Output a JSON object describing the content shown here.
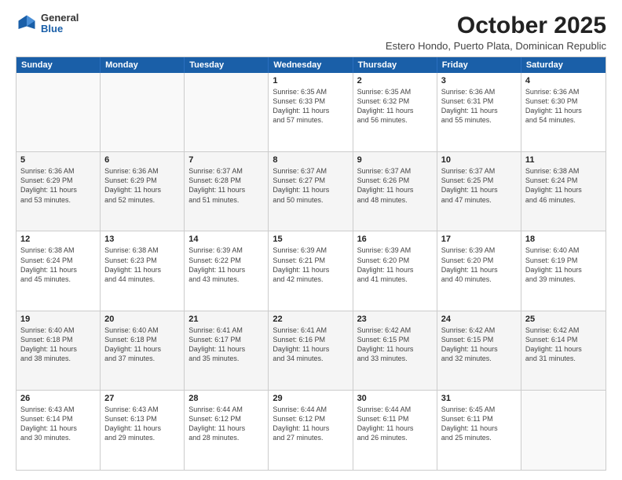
{
  "logo": {
    "general": "General",
    "blue": "Blue"
  },
  "header": {
    "month": "October 2025",
    "subtitle": "Estero Hondo, Puerto Plata, Dominican Republic"
  },
  "weekdays": [
    "Sunday",
    "Monday",
    "Tuesday",
    "Wednesday",
    "Thursday",
    "Friday",
    "Saturday"
  ],
  "rows": [
    [
      {
        "date": "",
        "info": ""
      },
      {
        "date": "",
        "info": ""
      },
      {
        "date": "",
        "info": ""
      },
      {
        "date": "1",
        "info": "Sunrise: 6:35 AM\nSunset: 6:33 PM\nDaylight: 11 hours\nand 57 minutes."
      },
      {
        "date": "2",
        "info": "Sunrise: 6:35 AM\nSunset: 6:32 PM\nDaylight: 11 hours\nand 56 minutes."
      },
      {
        "date": "3",
        "info": "Sunrise: 6:36 AM\nSunset: 6:31 PM\nDaylight: 11 hours\nand 55 minutes."
      },
      {
        "date": "4",
        "info": "Sunrise: 6:36 AM\nSunset: 6:30 PM\nDaylight: 11 hours\nand 54 minutes."
      }
    ],
    [
      {
        "date": "5",
        "info": "Sunrise: 6:36 AM\nSunset: 6:29 PM\nDaylight: 11 hours\nand 53 minutes."
      },
      {
        "date": "6",
        "info": "Sunrise: 6:36 AM\nSunset: 6:29 PM\nDaylight: 11 hours\nand 52 minutes."
      },
      {
        "date": "7",
        "info": "Sunrise: 6:37 AM\nSunset: 6:28 PM\nDaylight: 11 hours\nand 51 minutes."
      },
      {
        "date": "8",
        "info": "Sunrise: 6:37 AM\nSunset: 6:27 PM\nDaylight: 11 hours\nand 50 minutes."
      },
      {
        "date": "9",
        "info": "Sunrise: 6:37 AM\nSunset: 6:26 PM\nDaylight: 11 hours\nand 48 minutes."
      },
      {
        "date": "10",
        "info": "Sunrise: 6:37 AM\nSunset: 6:25 PM\nDaylight: 11 hours\nand 47 minutes."
      },
      {
        "date": "11",
        "info": "Sunrise: 6:38 AM\nSunset: 6:24 PM\nDaylight: 11 hours\nand 46 minutes."
      }
    ],
    [
      {
        "date": "12",
        "info": "Sunrise: 6:38 AM\nSunset: 6:24 PM\nDaylight: 11 hours\nand 45 minutes."
      },
      {
        "date": "13",
        "info": "Sunrise: 6:38 AM\nSunset: 6:23 PM\nDaylight: 11 hours\nand 44 minutes."
      },
      {
        "date": "14",
        "info": "Sunrise: 6:39 AM\nSunset: 6:22 PM\nDaylight: 11 hours\nand 43 minutes."
      },
      {
        "date": "15",
        "info": "Sunrise: 6:39 AM\nSunset: 6:21 PM\nDaylight: 11 hours\nand 42 minutes."
      },
      {
        "date": "16",
        "info": "Sunrise: 6:39 AM\nSunset: 6:20 PM\nDaylight: 11 hours\nand 41 minutes."
      },
      {
        "date": "17",
        "info": "Sunrise: 6:39 AM\nSunset: 6:20 PM\nDaylight: 11 hours\nand 40 minutes."
      },
      {
        "date": "18",
        "info": "Sunrise: 6:40 AM\nSunset: 6:19 PM\nDaylight: 11 hours\nand 39 minutes."
      }
    ],
    [
      {
        "date": "19",
        "info": "Sunrise: 6:40 AM\nSunset: 6:18 PM\nDaylight: 11 hours\nand 38 minutes."
      },
      {
        "date": "20",
        "info": "Sunrise: 6:40 AM\nSunset: 6:18 PM\nDaylight: 11 hours\nand 37 minutes."
      },
      {
        "date": "21",
        "info": "Sunrise: 6:41 AM\nSunset: 6:17 PM\nDaylight: 11 hours\nand 35 minutes."
      },
      {
        "date": "22",
        "info": "Sunrise: 6:41 AM\nSunset: 6:16 PM\nDaylight: 11 hours\nand 34 minutes."
      },
      {
        "date": "23",
        "info": "Sunrise: 6:42 AM\nSunset: 6:15 PM\nDaylight: 11 hours\nand 33 minutes."
      },
      {
        "date": "24",
        "info": "Sunrise: 6:42 AM\nSunset: 6:15 PM\nDaylight: 11 hours\nand 32 minutes."
      },
      {
        "date": "25",
        "info": "Sunrise: 6:42 AM\nSunset: 6:14 PM\nDaylight: 11 hours\nand 31 minutes."
      }
    ],
    [
      {
        "date": "26",
        "info": "Sunrise: 6:43 AM\nSunset: 6:14 PM\nDaylight: 11 hours\nand 30 minutes."
      },
      {
        "date": "27",
        "info": "Sunrise: 6:43 AM\nSunset: 6:13 PM\nDaylight: 11 hours\nand 29 minutes."
      },
      {
        "date": "28",
        "info": "Sunrise: 6:44 AM\nSunset: 6:12 PM\nDaylight: 11 hours\nand 28 minutes."
      },
      {
        "date": "29",
        "info": "Sunrise: 6:44 AM\nSunset: 6:12 PM\nDaylight: 11 hours\nand 27 minutes."
      },
      {
        "date": "30",
        "info": "Sunrise: 6:44 AM\nSunset: 6:11 PM\nDaylight: 11 hours\nand 26 minutes."
      },
      {
        "date": "31",
        "info": "Sunrise: 6:45 AM\nSunset: 6:11 PM\nDaylight: 11 hours\nand 25 minutes."
      },
      {
        "date": "",
        "info": ""
      }
    ]
  ]
}
